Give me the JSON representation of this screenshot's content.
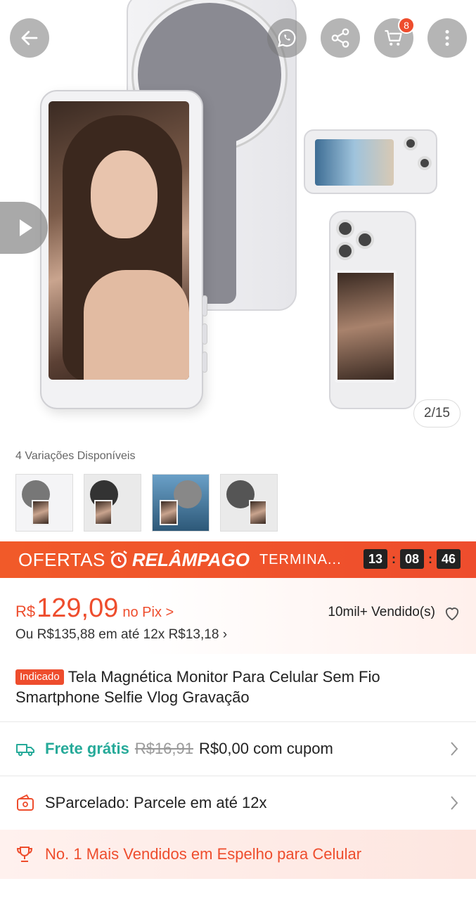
{
  "header": {
    "cart_count": "8",
    "image_counter": "2/15"
  },
  "variations": {
    "label": "4 Variações Disponíveis",
    "count": 4
  },
  "flash": {
    "label_a": "OFERTAS",
    "label_b": "RELÂMPAGO",
    "ends_label": "TERMINA...",
    "hours": "13",
    "minutes": "08",
    "seconds": "46"
  },
  "price": {
    "currency": "R$",
    "amount": "129,09",
    "method": "no Pix >",
    "installments": "Ou R$135,88 em até 12x R$13,18 ›",
    "sold": "10mil+ Vendido(s)"
  },
  "product": {
    "tag": "Indicado",
    "title": "Tela Magnética Monitor Para Celular Sem Fio Smartphone Selfie Vlog Gravação"
  },
  "shipping": {
    "free_label": "Frete grátis",
    "old_price": "R$16,91",
    "coupon_text": "R$0,00 com cupom"
  },
  "installment_row": {
    "text": "SParcelado: Parcele em até 12x"
  },
  "ranking": {
    "text": "No. 1 Mais Vendidos em Espelho para Celular"
  },
  "colors": {
    "accent": "#ee4d2d",
    "teal": "#26aa99"
  }
}
